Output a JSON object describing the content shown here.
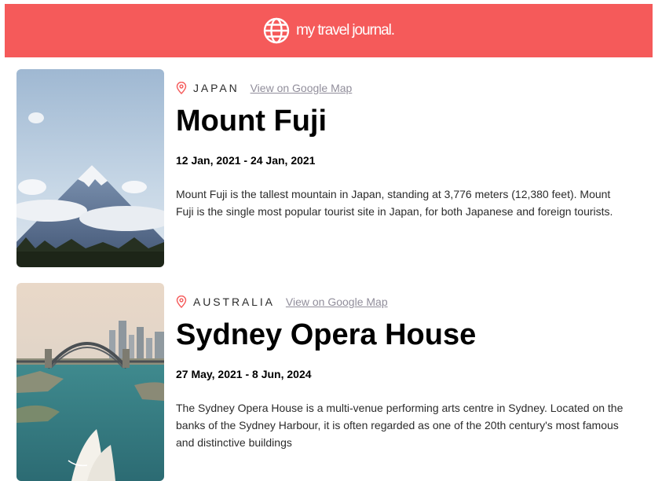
{
  "header": {
    "brand": "my travel journal.",
    "icon": "globe-icon",
    "color": "#f55a5a"
  },
  "entries": [
    {
      "country": "JAPAN",
      "map_link": "View on Google Map",
      "title": "Mount Fuji",
      "dates": "12 Jan, 2021 - 24 Jan, 2021",
      "description": "Mount Fuji is the tallest mountain in Japan, standing at 3,776 meters (12,380 feet). Mount Fuji is the single most popular tourist site in Japan, for both Japanese and foreign tourists.",
      "icon": "location-pin-icon"
    },
    {
      "country": "AUSTRALIA",
      "map_link": "View on Google Map",
      "title": "Sydney Opera House",
      "dates": "27 May, 2021 - 8 Jun, 2024",
      "description": "The Sydney Opera House is a multi-venue performing arts centre in Sydney. Located on the banks of the Sydney Harbour, it is often regarded as one of the 20th century's most famous and distinctive buildings",
      "icon": "location-pin-icon"
    }
  ]
}
